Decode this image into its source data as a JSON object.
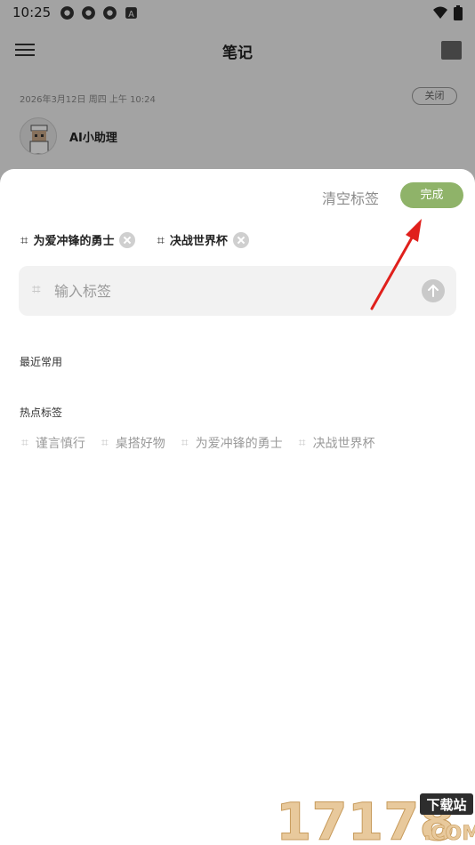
{
  "status_bar": {
    "time": "10:25"
  },
  "app_bar": {
    "title": "笔记"
  },
  "note": {
    "date": "2026年3月12日 周四 上午 10:24",
    "close_label": "关闭",
    "assistant_name": "AI小助理"
  },
  "sheet": {
    "clear_label": "清空标签",
    "done_label": "完成",
    "selected_tags": [
      {
        "label": "为爱冲锋的勇士"
      },
      {
        "label": "决战世界杯"
      }
    ],
    "input_placeholder": "输入标签",
    "recent_title": "最近常用",
    "hot_title": "热点标签",
    "hot_tags": [
      {
        "label": "谨言慎行"
      },
      {
        "label": "桌搭好物"
      },
      {
        "label": "为爱冲锋的勇士"
      },
      {
        "label": "决战世界杯"
      }
    ]
  },
  "colors": {
    "done_green": "#8fb369",
    "arrow_red": "#e0201c"
  },
  "watermark": {
    "main": "17178",
    "badge": "下载站",
    "suffix": ".COM"
  }
}
